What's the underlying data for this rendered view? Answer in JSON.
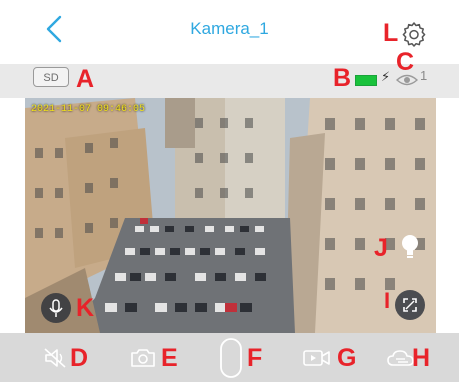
{
  "header": {
    "title": "Kamera_1"
  },
  "status": {
    "storage_label": "SD",
    "viewer_count": "1",
    "battery_color": "#19c23b"
  },
  "video": {
    "timestamp": "2021-11-07 09:46:05"
  },
  "annotations": {
    "A": "A",
    "B": "B",
    "C": "C",
    "D": "D",
    "E": "E",
    "F": "F",
    "G": "G",
    "H": "H",
    "I": "I",
    "J": "J",
    "K": "K",
    "L": "L"
  },
  "icons": {
    "back": "chevron-left-icon",
    "settings": "gear-icon",
    "battery": "battery-icon",
    "charging": "lightning-icon",
    "viewers": "eye-icon",
    "talk": "microphone-icon",
    "light": "lightbulb-icon",
    "fullscreen": "expand-icon",
    "mute": "speaker-muted-icon",
    "snapshot": "camera-icon",
    "record": "video-record-icon",
    "ptz": "cloud-icon"
  },
  "colors": {
    "accent": "#2fa8e0",
    "annotation": "#e8232a",
    "timestamp": "#f3e21a"
  }
}
